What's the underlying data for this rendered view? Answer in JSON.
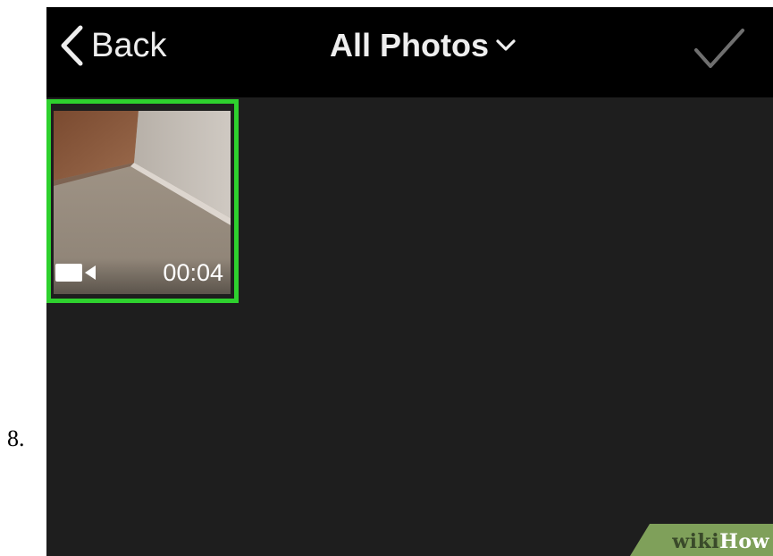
{
  "step": {
    "number": "8."
  },
  "nav": {
    "back_label": "Back",
    "title": "All Photos",
    "title_icon": "chevron-down-icon",
    "back_icon": "chevron-left-icon",
    "done_icon": "checkmark-icon"
  },
  "grid": {
    "items": [
      {
        "type": "video",
        "duration": "00:04",
        "selected": true,
        "icon": "video-camera-icon"
      }
    ]
  },
  "watermark": {
    "text_a": "wiki",
    "text_b": "How"
  },
  "colors": {
    "nav_background": "#000000",
    "screen_background": "#1e1e1e",
    "selection_border": "#2ed12e",
    "watermark_green": "#7fa05a"
  }
}
